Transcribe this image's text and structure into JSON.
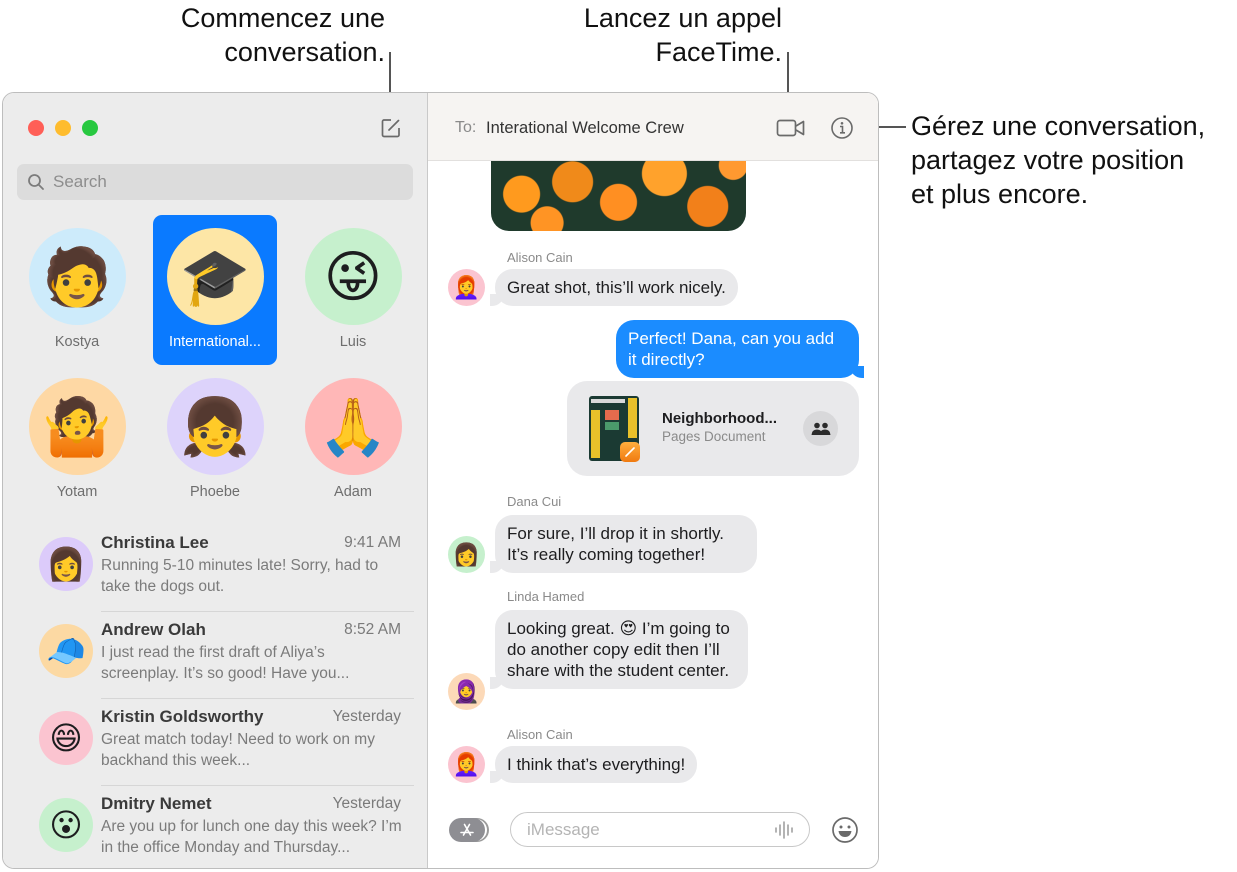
{
  "callouts": {
    "compose": [
      "Commencez une",
      "conversation."
    ],
    "facetime": [
      "Lancez un appel",
      "FaceTime."
    ],
    "info": [
      "Gérez une conversation,",
      "partagez votre position",
      "et plus encore."
    ]
  },
  "window": {
    "traffic_lights": {
      "close": "#ff5f57",
      "minimize": "#febc2e",
      "zoom": "#28c840"
    }
  },
  "sidebar": {
    "compose_icon": "compose-icon",
    "search": {
      "placeholder": "Search",
      "value": ""
    },
    "pinned": [
      {
        "label": "Kostya",
        "emoji": "🧑",
        "bg": "#cdebfb",
        "selected": false
      },
      {
        "label": "International...",
        "emoji": "🎓",
        "bg": "#fde6a6",
        "selected": true
      },
      {
        "label": "Luis",
        "emoji": "😜",
        "bg": "#c6f0cd",
        "selected": false
      },
      {
        "label": "Yotam",
        "emoji": "🤷",
        "bg": "#fed8a4",
        "selected": false
      },
      {
        "label": "Phoebe",
        "emoji": "👧",
        "bg": "#ddd3fb",
        "selected": false
      },
      {
        "label": "Adam",
        "emoji": "🙏",
        "bg": "#ffb7b7",
        "selected": false
      }
    ],
    "conversations": [
      {
        "name": "Christina Lee",
        "time": "9:41 AM",
        "preview": "Running 5-10 minutes late! Sorry, had to take the dogs out.",
        "emoji": "👩",
        "bg": "#dccbfa"
      },
      {
        "name": "Andrew Olah",
        "time": "8:52 AM",
        "preview": "I just read the first draft of Aliya’s screenplay. It’s so good! Have you...",
        "emoji": "🧢",
        "bg": "#fcd9a3"
      },
      {
        "name": "Kristin Goldsworthy",
        "time": "Yesterday",
        "preview": "Great match today! Need to work on my backhand this week...",
        "emoji": "😄",
        "bg": "#fbc4d0"
      },
      {
        "name": "Dmitry Nemet",
        "time": "Yesterday",
        "preview": "Are you up for lunch one day this week? I’m in the office Monday and Thursday...",
        "emoji": "😮",
        "bg": "#c6f0cd"
      }
    ]
  },
  "chat": {
    "to_label": "To:",
    "to_value": "Interational Welcome Crew",
    "messages": [
      {
        "sender": "Alison Cain",
        "text": "Great shot, this’ll work nicely.",
        "emoji": "👩‍🦰",
        "bg": "#fbc4d0"
      },
      {
        "sender": "",
        "text": "Perfect! Dana, can you add it directly?",
        "outgoing": true
      },
      {
        "sender": "Dana Cui",
        "text": "For sure, I’ll drop it in shortly. It’s really coming together!",
        "emoji": "👩",
        "bg": "#c6f0cd"
      },
      {
        "sender": "Linda Hamed",
        "text": "Looking great. 😍 I’m going to do another copy edit then I’ll share with the student center.",
        "emoji": "🧕",
        "bg": "#fcd9b8"
      },
      {
        "sender": "Alison Cain",
        "text": "I think that’s everything!",
        "emoji": "👩‍🦰",
        "bg": "#fbc4d0"
      }
    ],
    "attachment": {
      "title": "Neighborhood...",
      "subtitle": "Pages Document"
    },
    "input": {
      "placeholder": "iMessage",
      "value": ""
    }
  },
  "colors": {
    "accent": "#0a7aff",
    "outgoing_bubble": "#1b8cff",
    "incoming_bubble": "#e9e9eb"
  }
}
